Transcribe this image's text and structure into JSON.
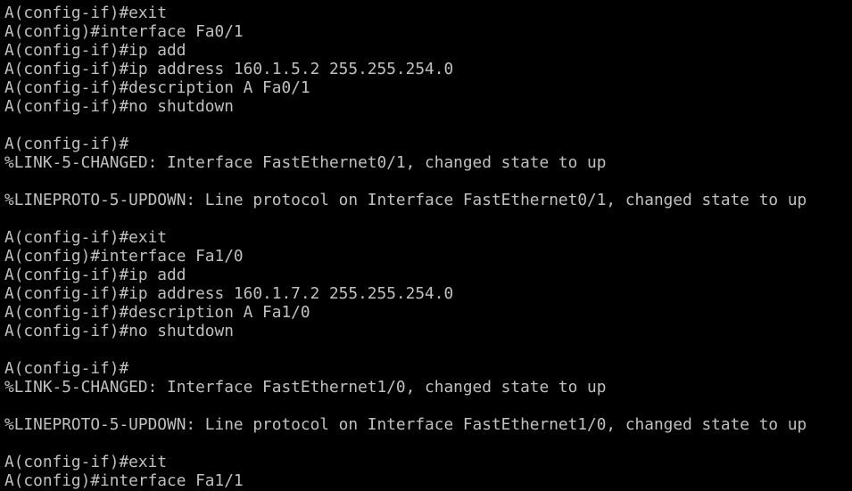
{
  "terminal": {
    "background": "#000000",
    "foreground": "#c0c0c0",
    "lines": [
      "A(config-if)#exit",
      "A(config)#interface Fa0/1",
      "A(config-if)#ip add",
      "A(config-if)#ip address 160.1.5.2 255.255.254.0",
      "A(config-if)#description A Fa0/1",
      "A(config-if)#no shutdown",
      "",
      "A(config-if)#",
      "%LINK-5-CHANGED: Interface FastEthernet0/1, changed state to up",
      "",
      "%LINEPROTO-5-UPDOWN: Line protocol on Interface FastEthernet0/1, changed state to up",
      "",
      "A(config-if)#exit",
      "A(config)#interface Fa1/0",
      "A(config-if)#ip add",
      "A(config-if)#ip address 160.1.7.2 255.255.254.0",
      "A(config-if)#description A Fa1/0",
      "A(config-if)#no shutdown",
      "",
      "A(config-if)#",
      "%LINK-5-CHANGED: Interface FastEthernet1/0, changed state to up",
      "",
      "%LINEPROTO-5-UPDOWN: Line protocol on Interface FastEthernet1/0, changed state to up",
      "",
      "A(config-if)#exit",
      "A(config)#interface Fa1/1"
    ]
  }
}
